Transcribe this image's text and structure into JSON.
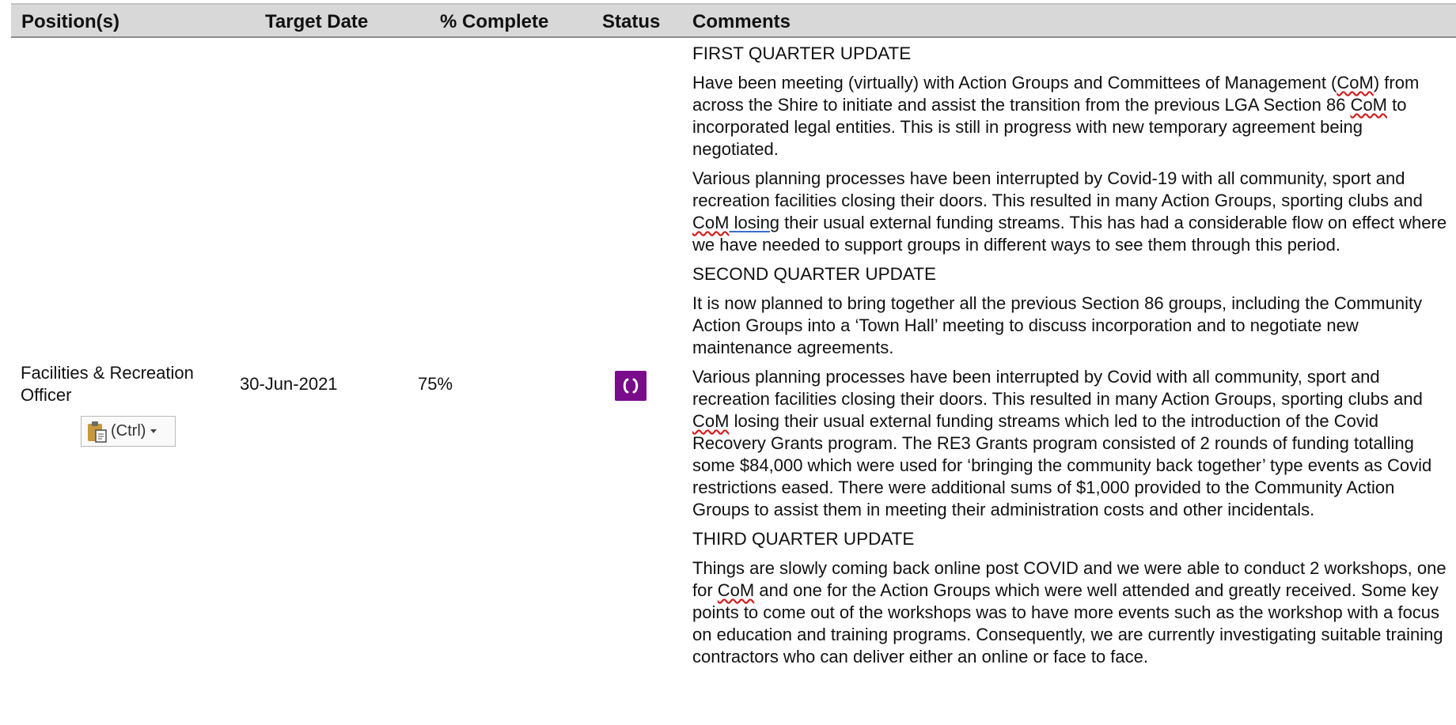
{
  "table": {
    "headers": {
      "position": "Position(s)",
      "target_date": "Target Date",
      "percent_complete": "% Complete",
      "status": "Status",
      "comments": "Comments"
    },
    "row": {
      "position": "Facilities & Recreation Officer",
      "target_date": "30-Jun-2021",
      "percent_complete": "75%",
      "status_icon": "in-progress-icon",
      "status_color": "#7a0c8c",
      "comments": {
        "q1_heading": "FIRST QUARTER UPDATE",
        "q1_p1": [
          "Have been meeting (virtually) with Action Groups and Committees of Management (",
          "CoM",
          ") from across the Shire to initiate and assist the transition from the previous LGA Section 86 ",
          "CoM",
          " to incorporated legal entities.  This is still in progress with new temporary agreement being negotiated."
        ],
        "q1_p2": [
          "Various planning processes have been interrupted by Covid-19 with all community, sport and recreation facilities closing their doors.  This resulted in many Action Groups, sporting clubs and ",
          "CoM",
          "  losing",
          " their usual external funding streams.  This has had a considerable flow on effect where we have needed to support groups in different ways to see them through this period."
        ],
        "q2_heading": "SECOND QUARTER UPDATE",
        "q2_p1": "It is now planned to bring together all the previous Section 86 groups, including the Community Action Groups into a ‘Town Hall’ meeting to discuss incorporation and to negotiate new maintenance agreements.",
        "q2_p2": [
          "Various planning processes have been interrupted by Covid with all community, sport and recreation facilities closing their doors.  This resulted in many Action Groups, sporting clubs and ",
          "CoM",
          " losing their usual external funding streams which led to the introduction of the Covid Recovery Grants program.  The RE3 Grants program consisted of 2 rounds of funding totalling some $84,000 which were used for ‘bringing the community back together’ type events as Covid restrictions eased.  There were additional sums of $1,000 provided to the Community Action Groups to assist them in meeting their administration costs and other incidentals."
        ],
        "q3_heading": "THIRD QUARTER UPDATE",
        "q3_p1": [
          "Things are slowly coming back online post COVID and we were able to conduct 2 workshops, one for ",
          "CoM",
          " and one for the Action Groups which were well attended and greatly received.  Some key points to come out of the workshops was to have more events such as the workshop with a focus on education and training programs.  Consequently, we are currently investigating suitable training contractors who can deliver either an online or face to face."
        ]
      }
    }
  },
  "paste_options": {
    "label": "(Ctrl)",
    "icon": "clipboard-icon"
  }
}
